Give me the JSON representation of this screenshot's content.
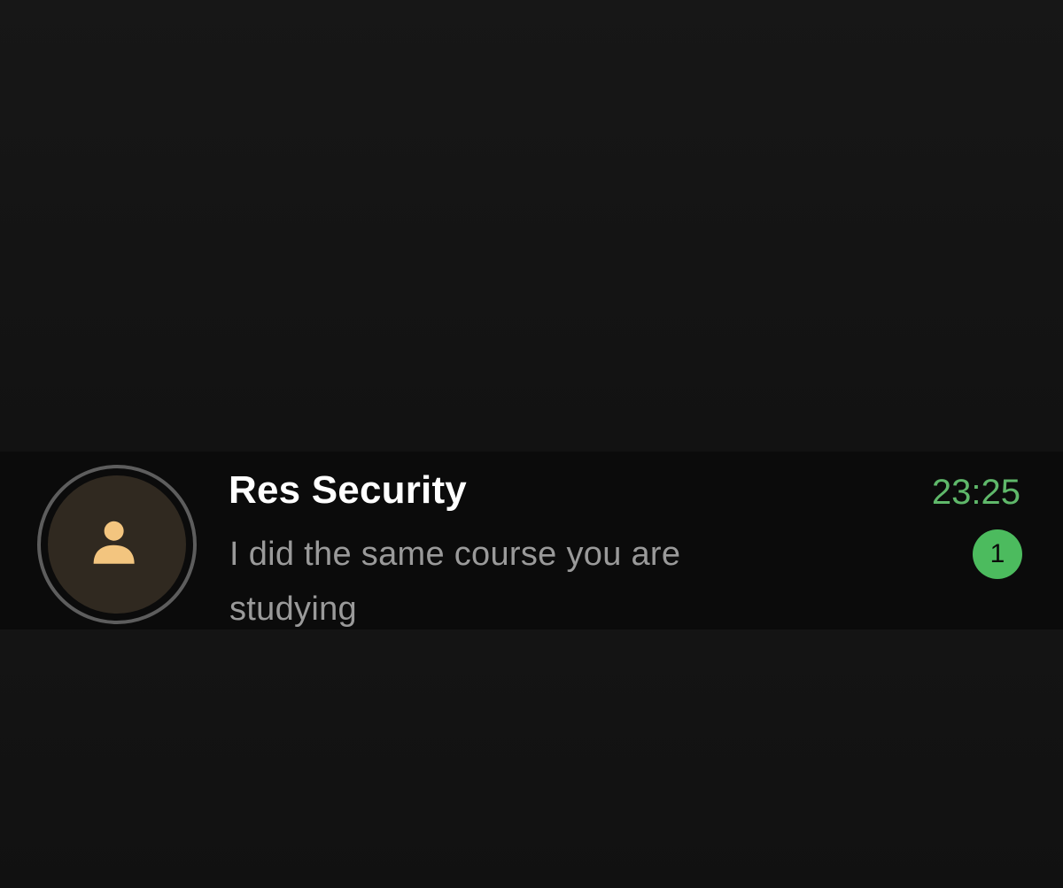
{
  "chat": {
    "contact_name": "Res Security",
    "message_preview": "I did the same course you are studying",
    "time": "23:25",
    "unread_count": "1",
    "avatar_icon": "person-icon"
  },
  "colors": {
    "background": "#121212",
    "row_background": "#0b0b0b",
    "avatar_fill": "#302920",
    "avatar_icon": "#f3c57f",
    "avatar_ring": "#5d5d5d",
    "accent_green": "#4cbb5e",
    "name_text": "#ffffff",
    "preview_text": "#9a9a9a"
  }
}
